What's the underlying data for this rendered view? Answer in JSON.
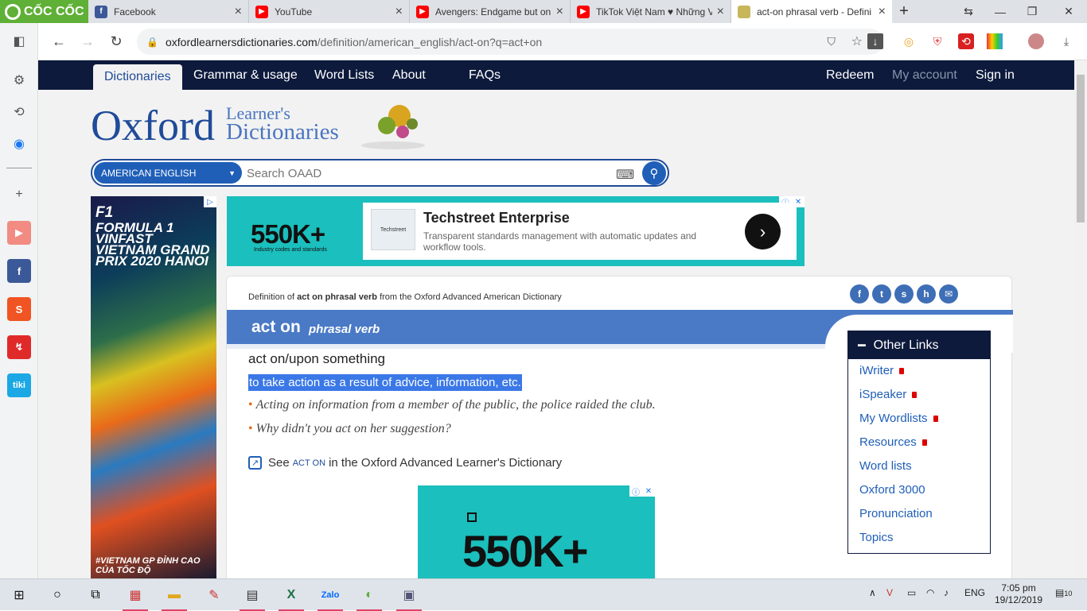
{
  "browser": {
    "logo_text": "CỐC CỐC",
    "tabs": [
      {
        "title": "Facebook",
        "icon": "facebook-icon",
        "color": "#3b5998",
        "active": false
      },
      {
        "title": "YouTube",
        "icon": "youtube-icon",
        "color": "#ff0000",
        "active": false
      },
      {
        "title": "Avengers: Endgame but onl",
        "icon": "youtube-icon",
        "color": "#ff0000",
        "active": false
      },
      {
        "title": "TikTok Việt Nam ♥ Những V",
        "icon": "youtube-icon",
        "color": "#ff0000",
        "active": false
      },
      {
        "title": "act-on phrasal verb - Defini",
        "icon": "oxford-icon",
        "color": "#8a7a3a",
        "active": true
      }
    ],
    "url_host": "oxfordlearnersdictionaries.com",
    "url_path": "/definition/american_english/act-on?q=act+on"
  },
  "site": {
    "nav_left": [
      "Dictionaries",
      "Grammar & usage",
      "Word Lists",
      "About",
      "FAQs"
    ],
    "nav_right": [
      "Redeem",
      "My account",
      "Sign in"
    ],
    "logo_main": "Oxford",
    "logo_line1": "Learner's",
    "logo_line2": "Dictionaries",
    "dict_select": "AMERICAN ENGLISH",
    "search_placeholder": "Search OAAD"
  },
  "ads": {
    "left": {
      "brand": "F1",
      "title": "FORMULA 1 VINFAST VIETNAM GRAND PRIX 2020 HANOI",
      "tagline": "#VIETNAM GP ĐỈNH CAO CỦA TỐC ĐỘ"
    },
    "top": {
      "big": "550K+",
      "small": "Industry codes and standards",
      "headline": "Techstreet Enterprise",
      "desc": "Transparent standards management with automatic updates and workflow tools.",
      "logo_text": "Techstreet"
    },
    "inline": {
      "big": "550K+"
    }
  },
  "entry": {
    "def_prefix": "Definition of ",
    "def_word": "act on phrasal verb",
    "def_suffix": " from the Oxford Advanced American Dictionary",
    "share_icons": [
      "facebook-icon",
      "twitter-icon",
      "stumbleupon-icon",
      "hi5-icon",
      "email-icon"
    ],
    "headword": "act on",
    "pos": "phrasal verb",
    "idiom": "act on/upon something",
    "definition": "to take action as a result of advice, information, etc.",
    "examples": [
      "Acting on information from a member of the public, the police raided the club.",
      "Why didn't you act on her suggestion?"
    ],
    "see_prefix": "See",
    "see_word": "ACT ON",
    "see_suffix": "in the Oxford Advanced Learner's Dictionary"
  },
  "other_links": {
    "title": "Other Links",
    "items": [
      {
        "label": "iWriter",
        "locked": true
      },
      {
        "label": "iSpeaker",
        "locked": true
      },
      {
        "label": "My Wordlists",
        "locked": true
      },
      {
        "label": "Resources",
        "locked": true
      },
      {
        "label": "Word lists",
        "locked": false
      },
      {
        "label": "Oxford 3000",
        "locked": false
      },
      {
        "label": "Pronunciation",
        "locked": false
      },
      {
        "label": "Topics",
        "locked": false
      }
    ]
  },
  "taskbar": {
    "language": "ENG",
    "time": "7:05 pm",
    "date": "19/12/2019",
    "notifications": "10"
  }
}
